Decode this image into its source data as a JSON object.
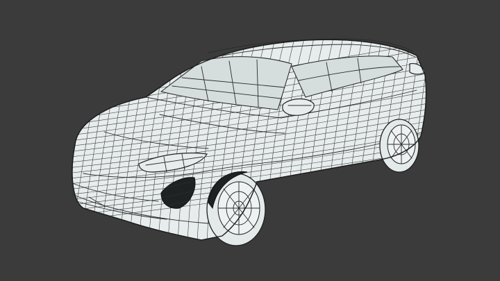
{
  "viewport": {
    "background_color": "#3b3b3b",
    "model_fill_color": "#e7ecec",
    "wire_color": "#2b2b2b"
  },
  "model": {
    "icon": "car-wireframe-icon"
  }
}
